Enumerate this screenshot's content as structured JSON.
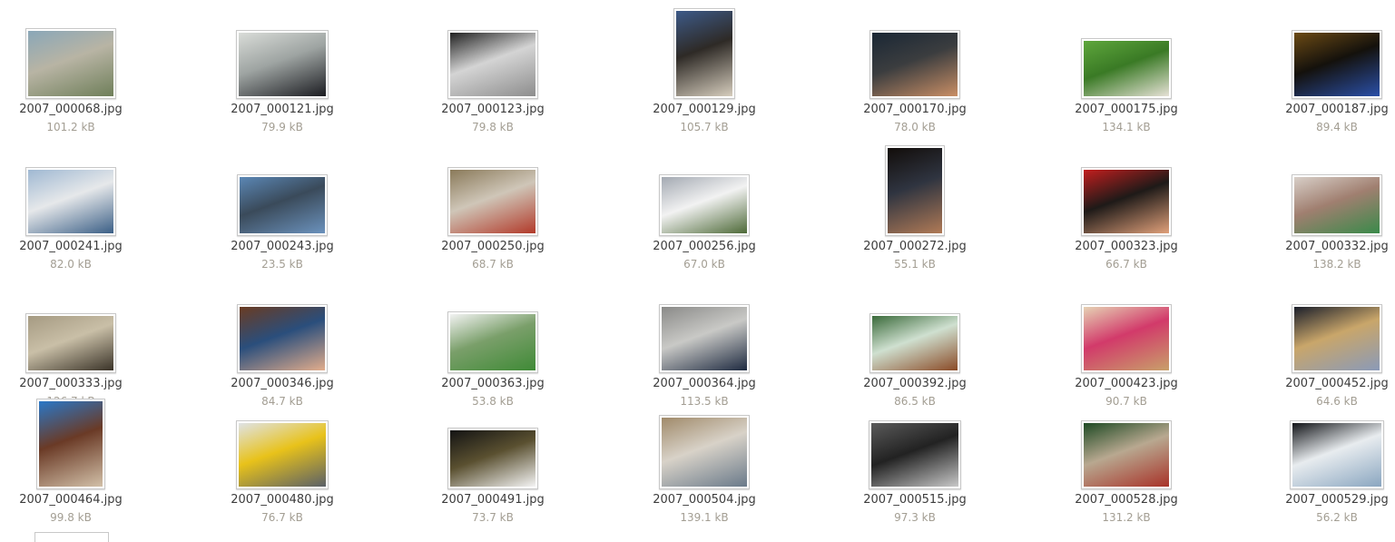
{
  "files": [
    {
      "name": "2007_000068.jpg",
      "size": "101.2 kB",
      "icon": "image-thumbnail-icon",
      "colors": [
        "#8aa7b8",
        "#6f7f5a",
        "#b8b4a4"
      ]
    },
    {
      "name": "2007_000121.jpg",
      "size": "79.9 kB",
      "icon": "image-thumbnail-icon",
      "colors": [
        "#d9dcd8",
        "#1c1d22",
        "#9ea4a2"
      ]
    },
    {
      "name": "2007_000123.jpg",
      "size": "79.8 kB",
      "icon": "image-thumbnail-icon",
      "colors": [
        "#222222",
        "#8d8d8d",
        "#d4d4d4"
      ]
    },
    {
      "name": "2007_000129.jpg",
      "size": "105.7 kB",
      "icon": "image-thumbnail-icon",
      "colors": [
        "#3d5a88",
        "#d6cdbd",
        "#2e2a26"
      ]
    },
    {
      "name": "2007_000170.jpg",
      "size": "78.0 kB",
      "icon": "image-thumbnail-icon",
      "colors": [
        "#1a2735",
        "#c98e65",
        "#3b3d3f"
      ]
    },
    {
      "name": "2007_000175.jpg",
      "size": "134.1 kB",
      "icon": "image-thumbnail-icon",
      "colors": [
        "#5ea63c",
        "#e6e1d6",
        "#3a7a25"
      ]
    },
    {
      "name": "2007_000187.jpg",
      "size": "89.4 kB",
      "icon": "image-thumbnail-icon",
      "colors": [
        "#6b4a14",
        "#2a4fa8",
        "#14110c"
      ]
    },
    {
      "name": "2007_000241.jpg",
      "size": "82.0 kB",
      "icon": "image-thumbnail-icon",
      "colors": [
        "#9fb8d2",
        "#3b5f86",
        "#e6e8ea"
      ]
    },
    {
      "name": "2007_000243.jpg",
      "size": "23.5 kB",
      "icon": "image-thumbnail-icon",
      "colors": [
        "#5b87b5",
        "#6b92bd",
        "#3a4a5a"
      ]
    },
    {
      "name": "2007_000250.jpg",
      "size": "68.7 kB",
      "icon": "image-thumbnail-icon",
      "colors": [
        "#8a7a5a",
        "#b23a2a",
        "#cfc6b8"
      ]
    },
    {
      "name": "2007_000256.jpg",
      "size": "67.0 kB",
      "icon": "image-thumbnail-icon",
      "colors": [
        "#a3a9b2",
        "#4e6a38",
        "#f2f2f2"
      ]
    },
    {
      "name": "2007_000272.jpg",
      "size": "55.1 kB",
      "icon": "image-thumbnail-icon",
      "colors": [
        "#120d0a",
        "#b07a56",
        "#2f3440"
      ]
    },
    {
      "name": "2007_000323.jpg",
      "size": "66.7 kB",
      "icon": "image-thumbnail-icon",
      "colors": [
        "#c21e1e",
        "#e0a07a",
        "#1e1a18"
      ]
    },
    {
      "name": "2007_000332.jpg",
      "size": "138.2 kB",
      "icon": "image-thumbnail-icon",
      "colors": [
        "#d8cfc8",
        "#3a8a4a",
        "#a07f70"
      ]
    },
    {
      "name": "2007_000333.jpg",
      "size": "126.7 kB",
      "icon": "image-thumbnail-icon",
      "colors": [
        "#a59a82",
        "#3a3328",
        "#c9bfa7"
      ]
    },
    {
      "name": "2007_000346.jpg",
      "size": "84.7 kB",
      "icon": "image-thumbnail-icon",
      "colors": [
        "#6a3b22",
        "#e2ad8c",
        "#2a4e7c"
      ]
    },
    {
      "name": "2007_000363.jpg",
      "size": "53.8 kB",
      "icon": "image-thumbnail-icon",
      "colors": [
        "#f2f2f2",
        "#3f8a36",
        "#7a9f6a"
      ]
    },
    {
      "name": "2007_000364.jpg",
      "size": "113.5 kB",
      "icon": "image-thumbnail-icon",
      "colors": [
        "#8a8a88",
        "#1e2a40",
        "#c9c9c6"
      ]
    },
    {
      "name": "2007_000392.jpg",
      "size": "86.5 kB",
      "icon": "image-thumbnail-icon",
      "colors": [
        "#3a6a3a",
        "#8a4a26",
        "#cfe0d0"
      ]
    },
    {
      "name": "2007_000423.jpg",
      "size": "90.7 kB",
      "icon": "image-thumbnail-icon",
      "colors": [
        "#e6d2b4",
        "#c8a06a",
        "#d23a6a"
      ]
    },
    {
      "name": "2007_000452.jpg",
      "size": "64.6 kB",
      "icon": "image-thumbnail-icon",
      "colors": [
        "#1a1e2a",
        "#8a9ab8",
        "#c9a66a"
      ]
    },
    {
      "name": "2007_000464.jpg",
      "size": "99.8 kB",
      "icon": "image-thumbnail-icon",
      "colors": [
        "#2a78c8",
        "#d2c0a8",
        "#6a3a26"
      ]
    },
    {
      "name": "2007_000480.jpg",
      "size": "76.7 kB",
      "icon": "image-thumbnail-icon",
      "colors": [
        "#dfe3e6",
        "#5a6068",
        "#e8c21a"
      ]
    },
    {
      "name": "2007_000491.jpg",
      "size": "73.7 kB",
      "icon": "image-thumbnail-icon",
      "colors": [
        "#141414",
        "#f4f4f4",
        "#5a5030"
      ]
    },
    {
      "name": "2007_000504.jpg",
      "size": "139.1 kB",
      "icon": "image-thumbnail-icon",
      "colors": [
        "#a08a6a",
        "#6a7a8a",
        "#d8d2c8"
      ]
    },
    {
      "name": "2007_000515.jpg",
      "size": "97.3 kB",
      "icon": "image-thumbnail-icon",
      "colors": [
        "#5a5a5a",
        "#c8c8c8",
        "#222222"
      ]
    },
    {
      "name": "2007_000528.jpg",
      "size": "131.2 kB",
      "icon": "image-thumbnail-icon",
      "colors": [
        "#1e4a24",
        "#a83228",
        "#b8a890"
      ]
    },
    {
      "name": "2007_000529.jpg",
      "size": "56.2 kB",
      "icon": "image-thumbnail-icon",
      "colors": [
        "#121418",
        "#8aa6c0",
        "#e8ecef"
      ]
    }
  ]
}
